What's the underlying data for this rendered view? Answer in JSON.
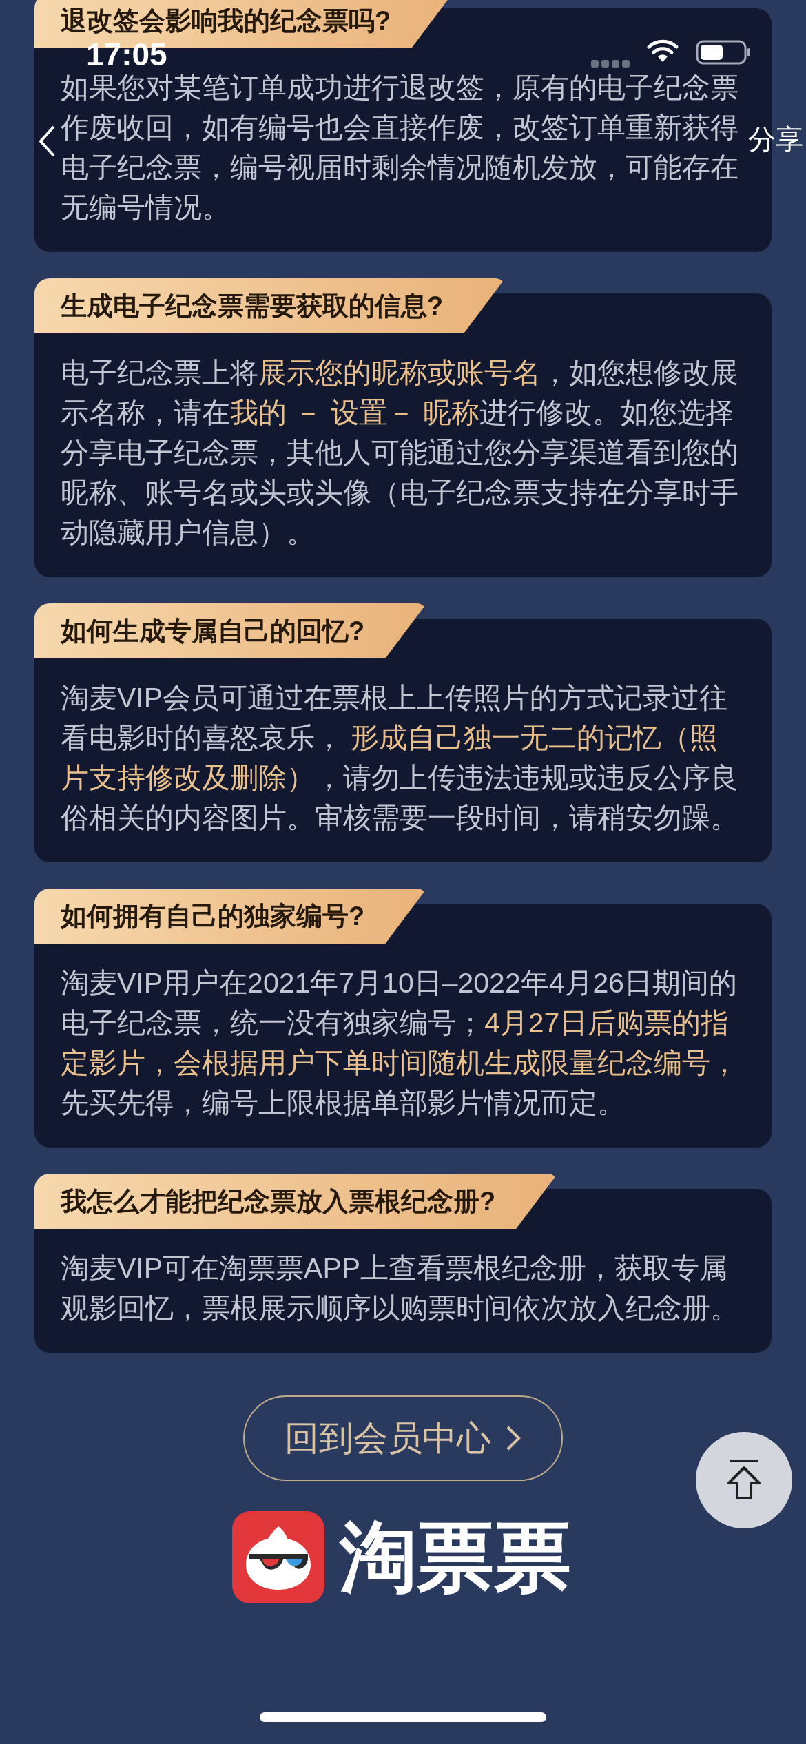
{
  "status_bar": {
    "time": "17:05"
  },
  "nav": {
    "share": "分享"
  },
  "faq": [
    {
      "question": "退改签会影响我的纪念票吗?",
      "answer": [
        {
          "text": "如果您对某笔订单成功进行退改签，原有的电子纪念票作废收回，如有编号也会直接作废，改签订单重新获得电子纪念票，编号视届时剩余情况随机发放，可能存在无编号情况。",
          "highlight": false
        }
      ]
    },
    {
      "question": "生成电子纪念票需要获取的信息?",
      "answer": [
        {
          "text": "电子纪念票上将",
          "highlight": false
        },
        {
          "text": "展示您的昵称或账号名",
          "highlight": true
        },
        {
          "text": "，如您想修改展示名称，请在",
          "highlight": false
        },
        {
          "text": "我的 － 设置－ 昵称",
          "highlight": true
        },
        {
          "text": "进行修改。如您选择分享电子纪念票，其他人可能通过您分享渠道看到您的昵称、账号名或头或头像（电子纪念票支持在分享时手动隐藏用户信息）。",
          "highlight": false
        }
      ]
    },
    {
      "question": "如何生成专属自己的回忆?",
      "answer": [
        {
          "text": "淘麦VIP会员可通过在票根上上传照片的方式记录过往看电影时的喜怒哀乐， ",
          "highlight": false
        },
        {
          "text": "形成自己独一无二的记忆（照片支持修改及删除）",
          "highlight": true
        },
        {
          "text": "，请勿上传违法违规或违反公序良俗相关的内容图片。审核需要一段时间，请稍安勿躁。",
          "highlight": false
        }
      ]
    },
    {
      "question": "如何拥有自己的独家编号?",
      "answer": [
        {
          "text": "淘麦VIP用户在2021年7月10日–2022年4月26日期间的电子纪念票，统一没有独家编号；",
          "highlight": false
        },
        {
          "text": "4月27日后购票的指定影片，会根据用户下单时间随机生成限量纪念编号，",
          "highlight": true
        },
        {
          "text": "先买先得，编号上限根据单部影片情况而定。",
          "highlight": false
        }
      ]
    },
    {
      "question": "我怎么才能把纪念票放入票根纪念册?",
      "answer": [
        {
          "text": "淘麦VIP可在淘票票APP上查看票根纪念册，获取专属观影回忆，票根展示顺序以购票时间依次放入纪念册。",
          "highlight": false
        }
      ]
    }
  ],
  "back_button": {
    "label": "回到会员中心"
  },
  "logo": {
    "text": "淘票票"
  }
}
